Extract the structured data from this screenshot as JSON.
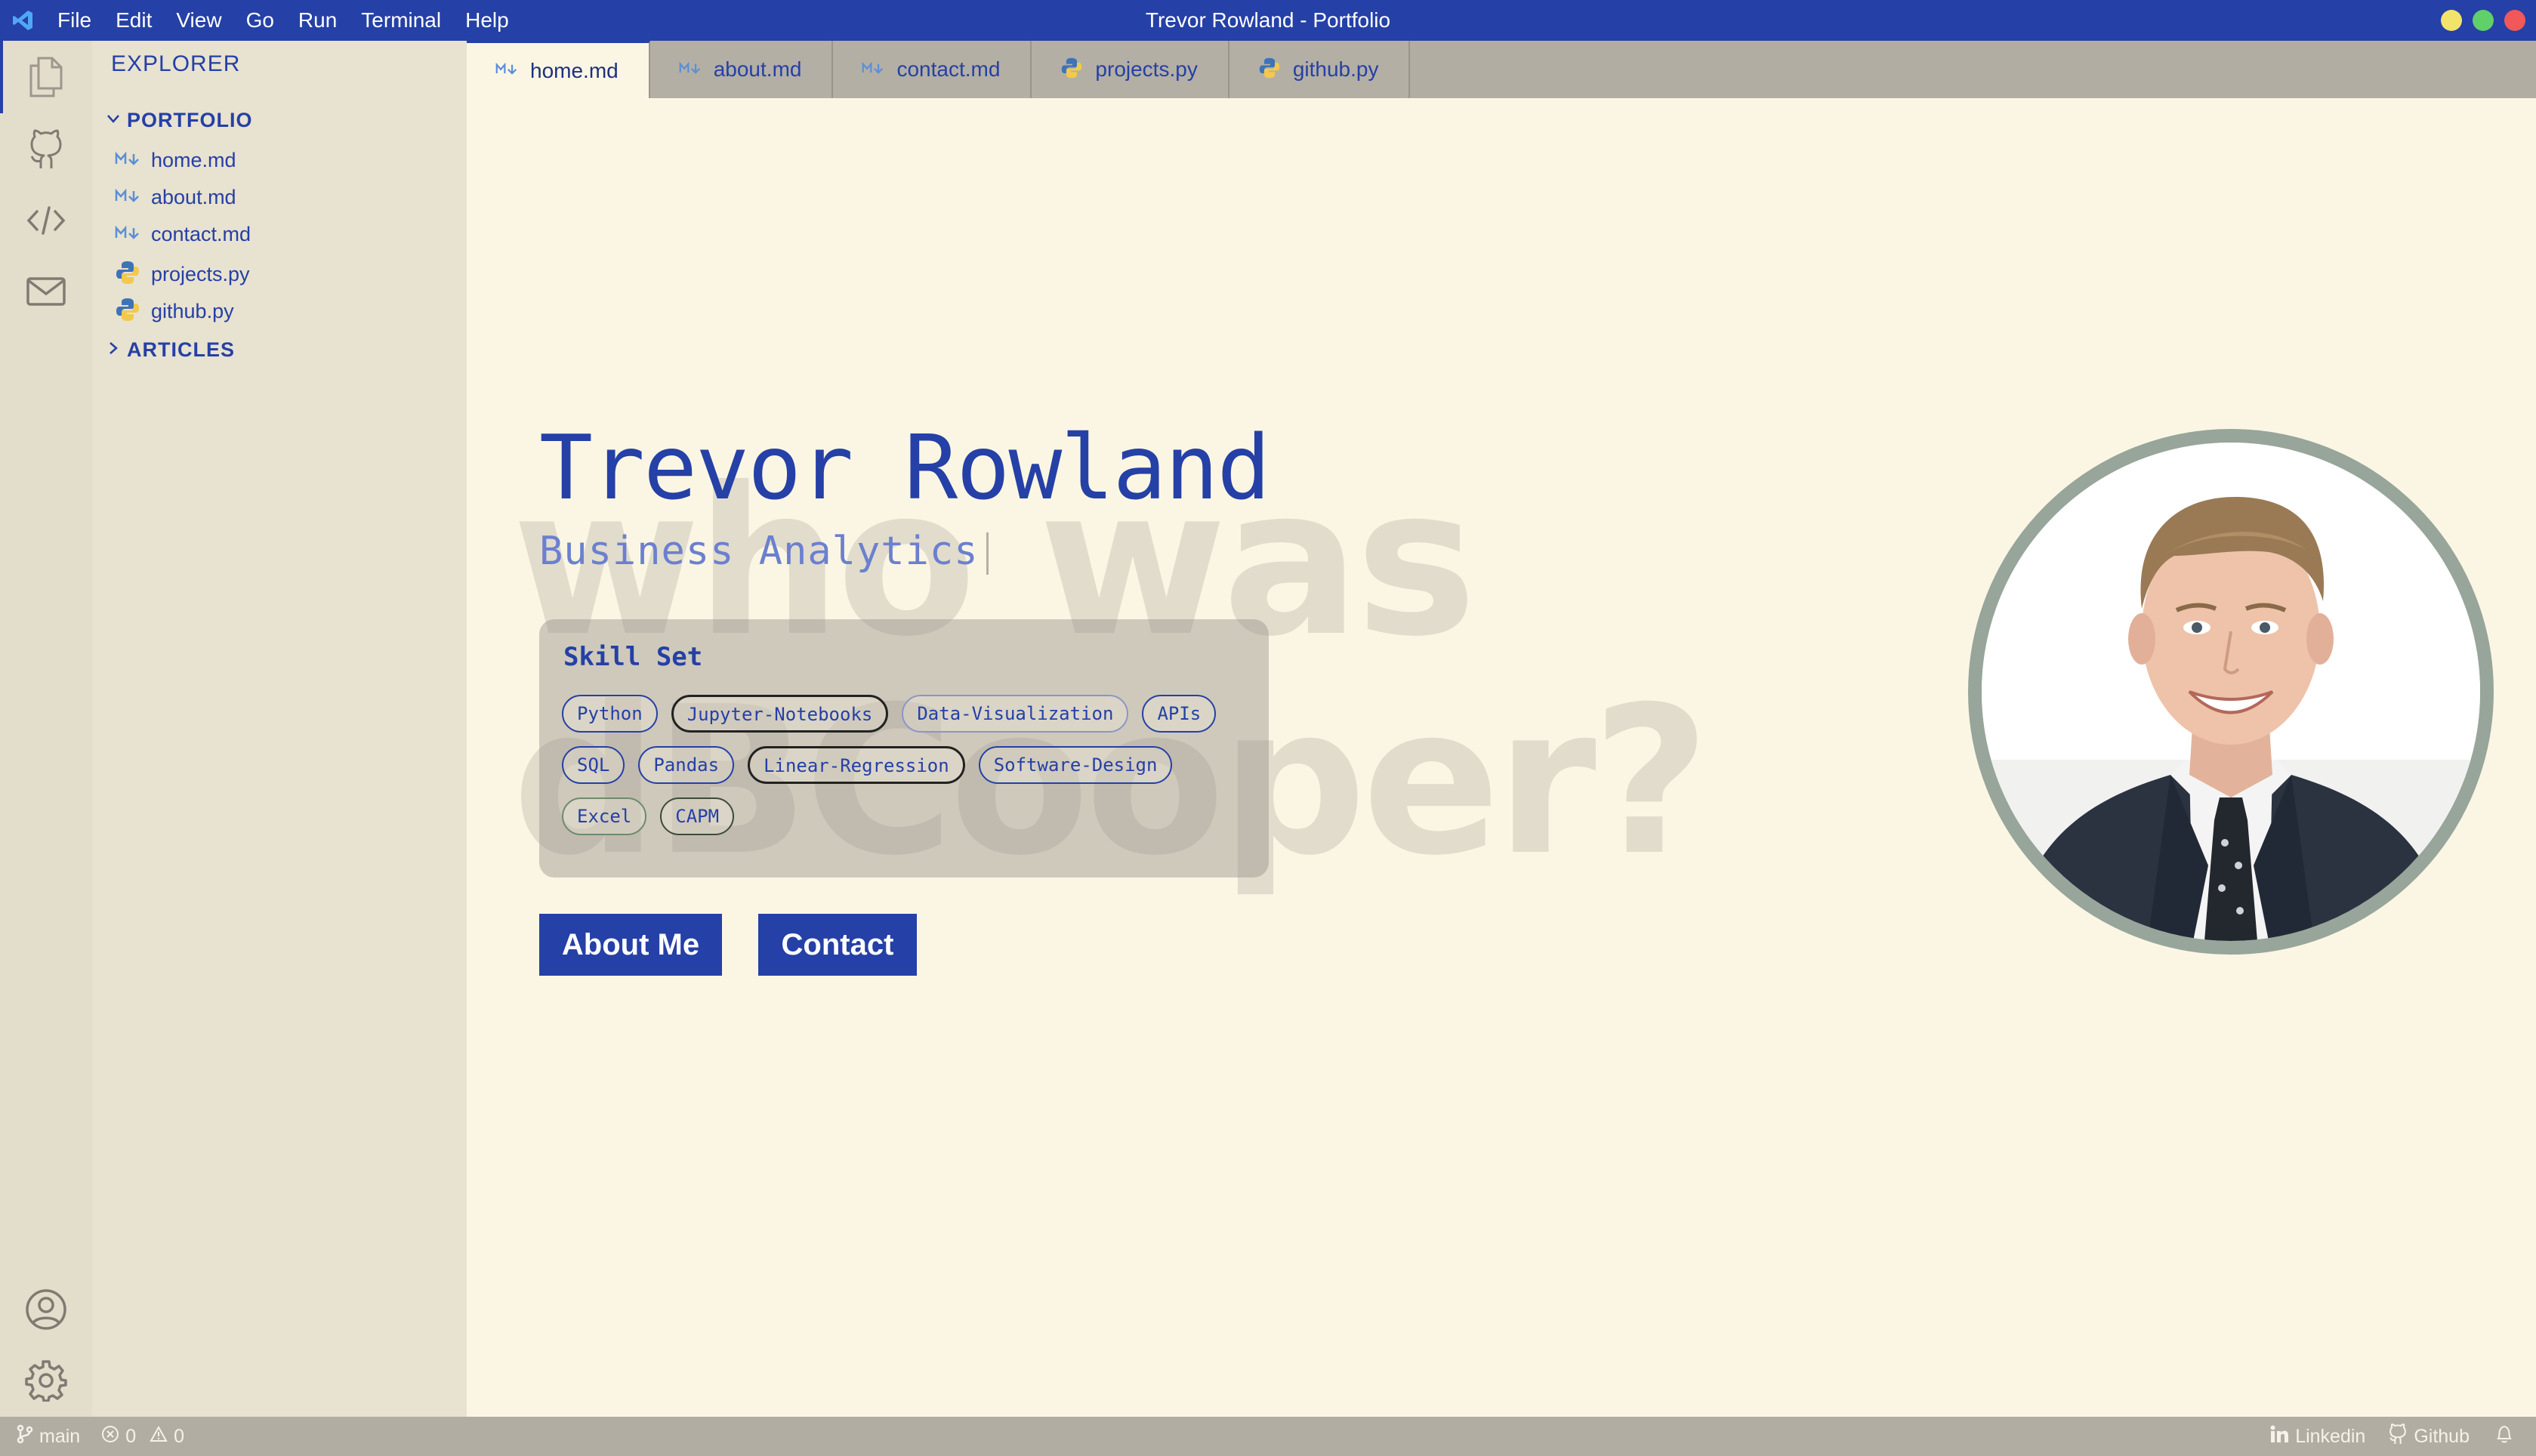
{
  "window": {
    "title": "Trevor Rowland - Portfolio"
  },
  "menu": [
    "File",
    "Edit",
    "View",
    "Go",
    "Run",
    "Terminal",
    "Help"
  ],
  "colors": {
    "accent": "#2540a6",
    "background": "#fbf6e4",
    "sidebar": "#e8e2d0",
    "activitybar": "#e3ddcb",
    "tabbar": "#b2ada2",
    "photo_ring": "#97a59a"
  },
  "activity": {
    "top": [
      "files-icon",
      "github-icon",
      "code-icon",
      "mail-icon"
    ],
    "bottom": [
      "account-icon",
      "settings-icon"
    ]
  },
  "sidebar": {
    "title": "EXPLORER",
    "folder": "PORTFOLIO",
    "files": [
      {
        "name": "home.md",
        "icon": "markdown-icon"
      },
      {
        "name": "about.md",
        "icon": "markdown-icon"
      },
      {
        "name": "contact.md",
        "icon": "markdown-icon"
      },
      {
        "name": "projects.py",
        "icon": "python-icon"
      },
      {
        "name": "github.py",
        "icon": "python-icon"
      }
    ],
    "collapsed_folder": "ARTICLES"
  },
  "tabs": [
    {
      "name": "home.md",
      "icon": "markdown-icon",
      "active": true
    },
    {
      "name": "about.md",
      "icon": "markdown-icon"
    },
    {
      "name": "contact.md",
      "icon": "markdown-icon"
    },
    {
      "name": "projects.py",
      "icon": "python-icon"
    },
    {
      "name": "github.py",
      "icon": "python-icon"
    }
  ],
  "hero": {
    "name": "Trevor Rowland",
    "subtitle": "Business Analytics",
    "background_text_line1": "who was",
    "background_text_line2": "dBCooper?",
    "skills_title": "Skill Set",
    "skills_rows": [
      [
        "Python",
        "Jupyter-Notebooks",
        "Data-Visualization",
        "APIs"
      ],
      [
        "SQL",
        "Pandas",
        "Linear-Regression",
        "Software-Design"
      ],
      [
        "Excel",
        "CAPM"
      ]
    ],
    "about_button": "About Me",
    "contact_button": "Contact"
  },
  "statusbar": {
    "branch": "main",
    "errors": "0",
    "warnings": "0",
    "linkedin": "Linkedin",
    "github": "Github"
  }
}
